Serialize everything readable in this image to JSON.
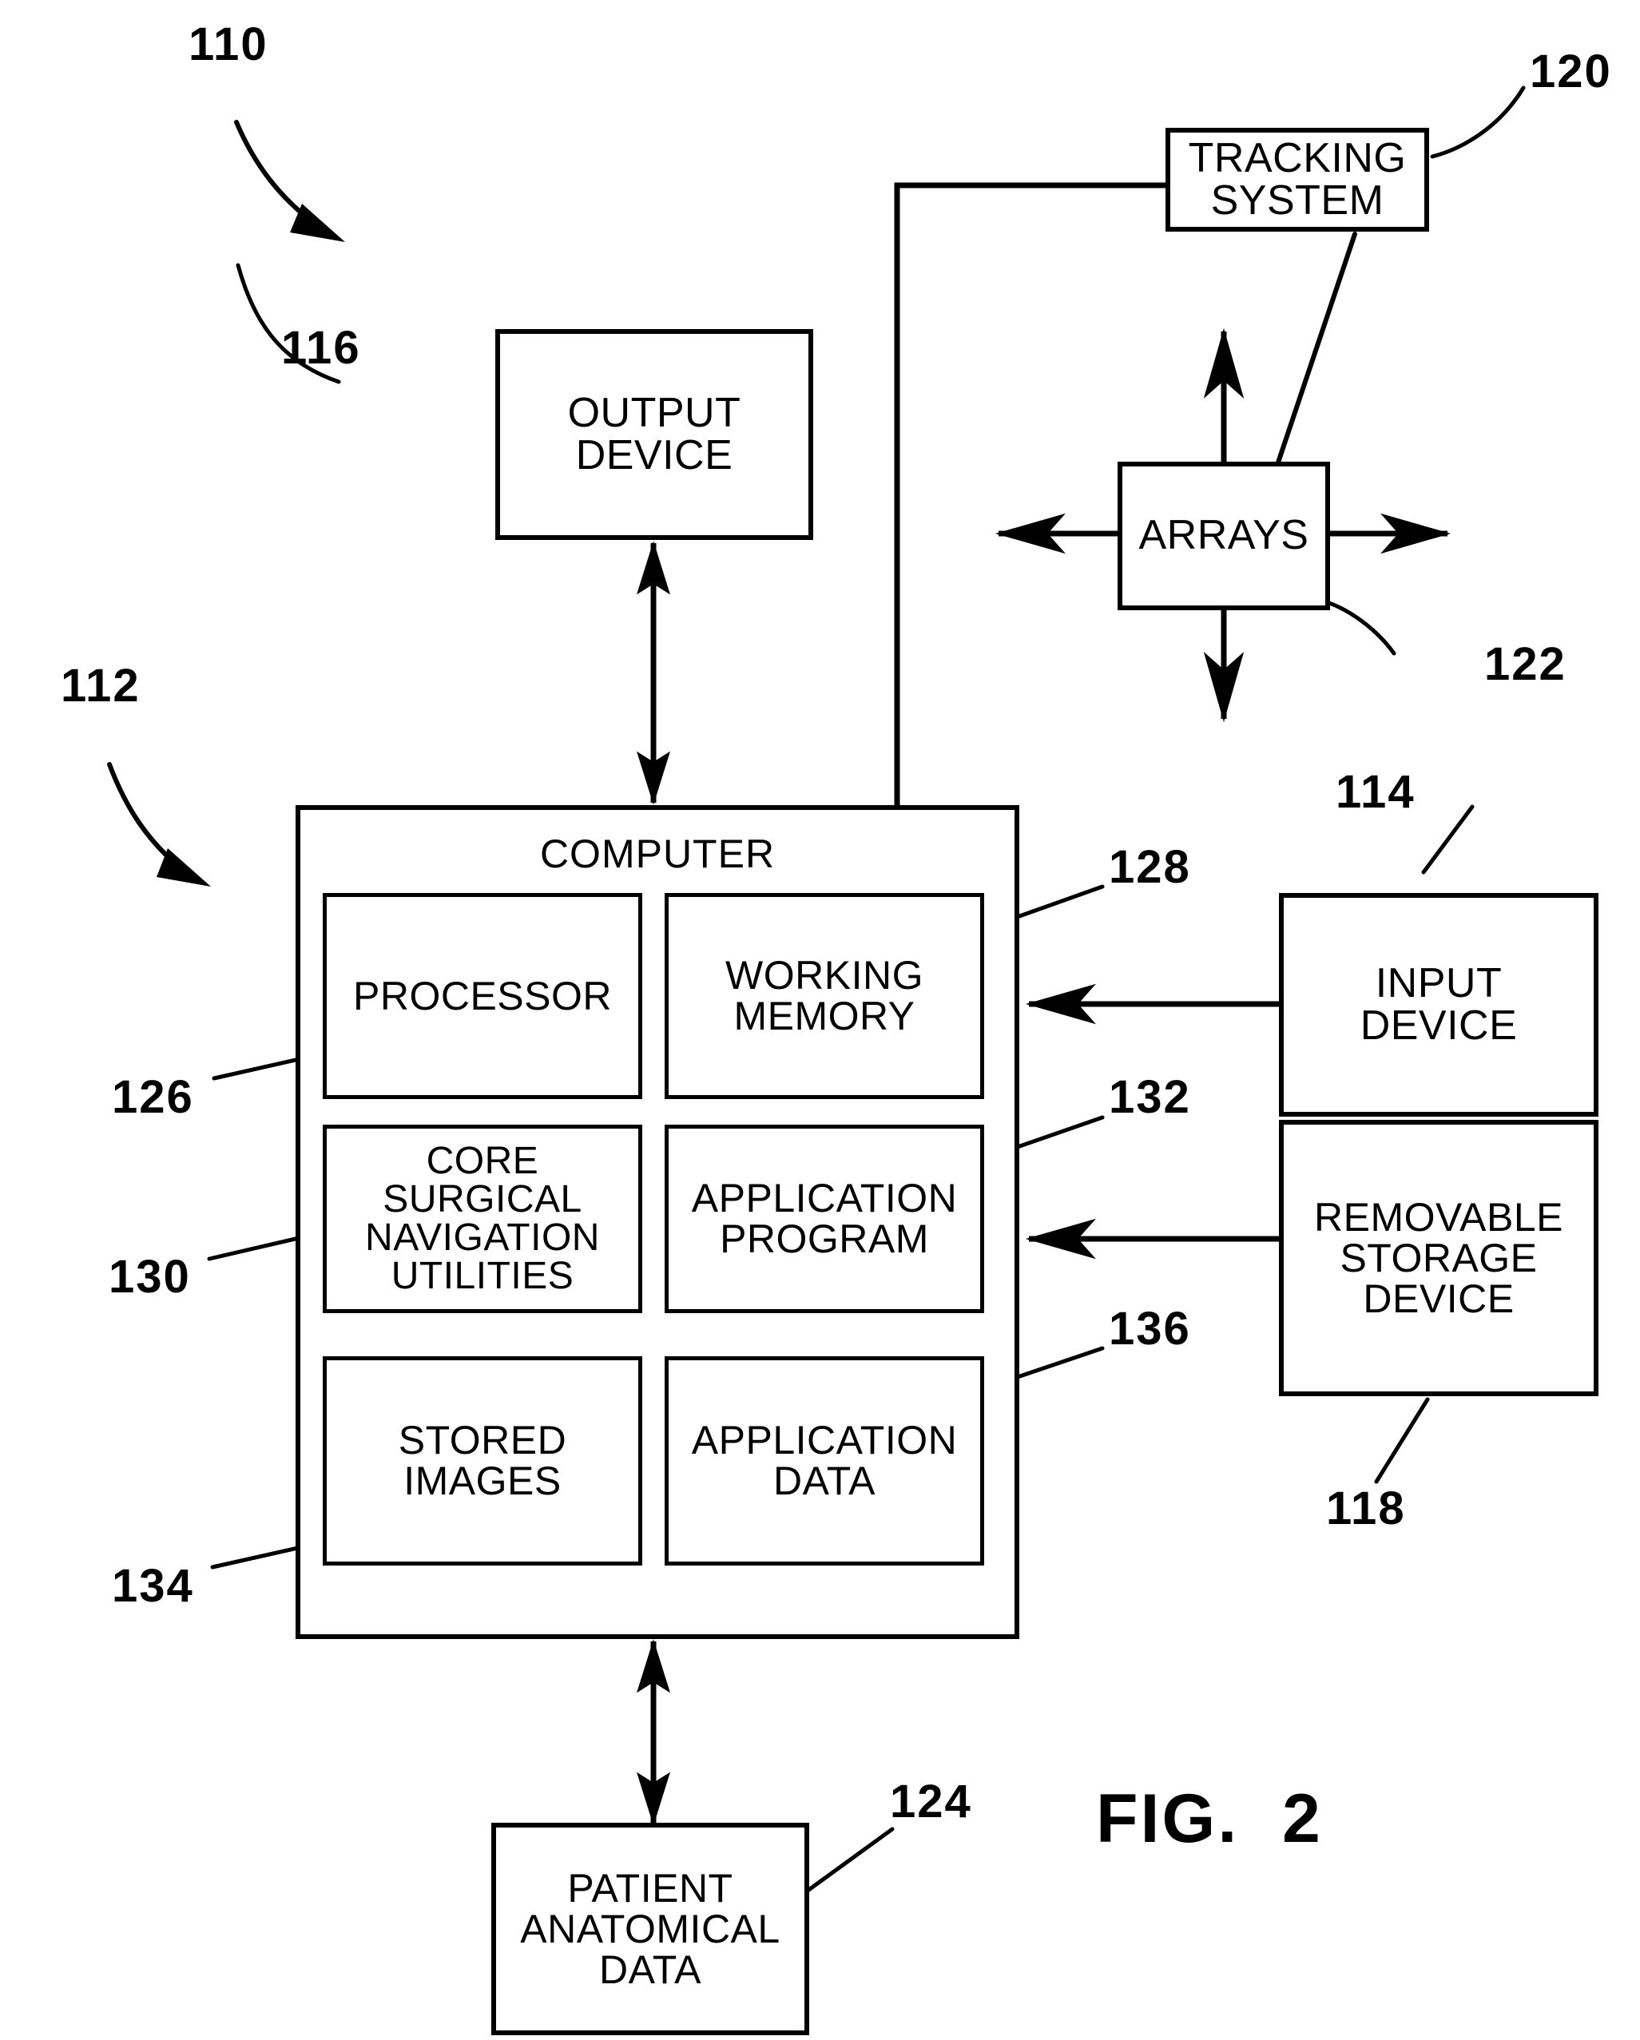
{
  "figure": {
    "caption": "FIG.  2"
  },
  "blocks": {
    "tracking_system": {
      "label": "TRACKING\nSYSTEM",
      "ref": "120"
    },
    "arrays": {
      "label": "ARRAYS",
      "ref": "122"
    },
    "output_device": {
      "label": "OUTPUT\nDEVICE",
      "ref": "116"
    },
    "computer": {
      "label": "COMPUTER",
      "ref": "112"
    },
    "input_device": {
      "label": "INPUT\nDEVICE",
      "ref": "114"
    },
    "removable_storage": {
      "label": "REMOVABLE\nSTORAGE\nDEVICE",
      "ref": "118"
    },
    "patient_data": {
      "label": "PATIENT\nANATOMICAL\nDATA",
      "ref": "124"
    },
    "processor": {
      "label": "PROCESSOR",
      "ref": "126"
    },
    "working_memory": {
      "label": "WORKING\nMEMORY",
      "ref": "128"
    },
    "core_utilities": {
      "label": "CORE\nSURGICAL\nNAVIGATION\nUTILITIES",
      "ref": "130"
    },
    "application_program": {
      "label": "APPLICATION\nPROGRAM",
      "ref": "132"
    },
    "stored_images": {
      "label": "STORED\nIMAGES",
      "ref": "134"
    },
    "application_data": {
      "label": "APPLICATION\nDATA",
      "ref": "136"
    }
  },
  "system": {
    "ref": "110"
  },
  "refnums": {
    "r110": "110",
    "r112": "112",
    "r114": "114",
    "r116": "116",
    "r118": "118",
    "r120": "120",
    "r122": "122",
    "r124": "124",
    "r126": "126",
    "r128": "128",
    "r130": "130",
    "r132": "132",
    "r134": "134",
    "r136": "136"
  },
  "colors": {
    "line": "#000000",
    "background": "#ffffff"
  }
}
